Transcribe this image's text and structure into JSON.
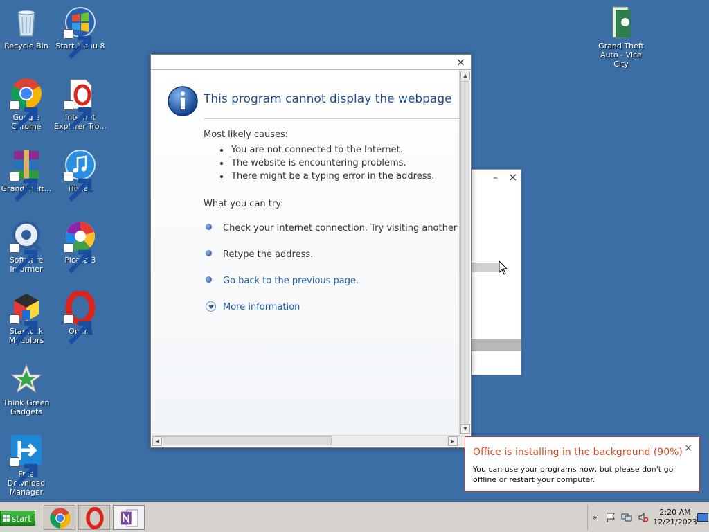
{
  "desktop": {
    "icons": [
      {
        "label": "Recycle Bin"
      },
      {
        "label": "Start Menu 8"
      },
      {
        "label": "Google Chrome"
      },
      {
        "label": "Internet Explorer Tro..."
      },
      {
        "label": "GrandTheft..."
      },
      {
        "label": "iTunes"
      },
      {
        "label": "Software Informer"
      },
      {
        "label": "Picasa 3"
      },
      {
        "label": "Stardock MyColors"
      },
      {
        "label": "Opera"
      },
      {
        "label": "Think Green Gadgets"
      },
      {
        "label": "Free Download Manager"
      },
      {
        "label": "Grand Theft Auto - Vice City"
      }
    ]
  },
  "dialog": {
    "close_glyph": "×",
    "title": "This program cannot display the webpage",
    "causes_heading": "Most likely causes:",
    "causes": [
      "You are not connected to the Internet.",
      "The website is encountering problems.",
      "There might be a typing error in the address."
    ],
    "try_heading": "What you can try:",
    "try_items": [
      "Check your Internet connection. Try visiting another wel",
      "Retype the address.",
      "Go back to the previous page."
    ],
    "more_info": "More information"
  },
  "background_window": {
    "minimize_glyph": "–",
    "close_glyph": "×"
  },
  "toast": {
    "title": "Office is installing in the background (90%)",
    "body": "You can use your programs now, but please don't go offline or restart your computer.",
    "close_glyph": "×",
    "progress_percent": 90
  },
  "taskbar": {
    "start_label": "start",
    "tray_chevron": "»",
    "clock_time": "2:20 AM",
    "clock_date": "12/21/2023"
  },
  "colors": {
    "desktop_bg": "#3b6ea5",
    "dialog_title": "#1f4e8c",
    "link": "#1f5fa8",
    "toast_title": "#d14b1f",
    "start_button": "#2ea52e"
  }
}
